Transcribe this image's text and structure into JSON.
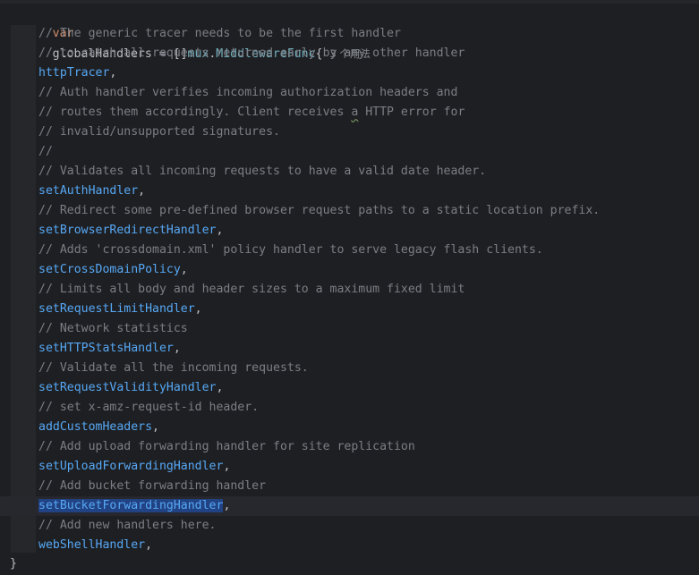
{
  "editor": {
    "declaration": {
      "keyword": "var",
      "name": "globalHandlers",
      "assign": " = ",
      "brackets": "[]",
      "package": "mux",
      "dot": ".",
      "type": "MiddlewareFunc",
      "brace": "{",
      "usage_hint": "3 个用法"
    },
    "lines": [
      {
        "kind": "comment",
        "text": "// The generic tracer needs to be the first handler"
      },
      {
        "kind": "comment",
        "text": "// to catch all requests returned early by any other handler"
      },
      {
        "kind": "handler",
        "name": "httpTracer",
        "suffix": ","
      },
      {
        "kind": "comment",
        "text": "// Auth handler verifies incoming authorization headers and"
      },
      {
        "kind": "comment_typo",
        "before": "// routes them accordingly. Client receives ",
        "typo": "a",
        "after": " HTTP error for"
      },
      {
        "kind": "comment",
        "text": "// invalid/unsupported signatures."
      },
      {
        "kind": "comment",
        "text": "//"
      },
      {
        "kind": "comment",
        "text": "// Validates all incoming requests to have a valid date header."
      },
      {
        "kind": "handler",
        "name": "setAuthHandler",
        "suffix": ","
      },
      {
        "kind": "comment",
        "text": "// Redirect some pre-defined browser request paths to a static location prefix."
      },
      {
        "kind": "handler",
        "name": "setBrowserRedirectHandler",
        "suffix": ","
      },
      {
        "kind": "comment",
        "text": "// Adds 'crossdomain.xml' policy handler to serve legacy flash clients."
      },
      {
        "kind": "handler",
        "name": "setCrossDomainPolicy",
        "suffix": ","
      },
      {
        "kind": "comment",
        "text": "// Limits all body and header sizes to a maximum fixed limit"
      },
      {
        "kind": "handler",
        "name": "setRequestLimitHandler",
        "suffix": ","
      },
      {
        "kind": "comment",
        "text": "// Network statistics"
      },
      {
        "kind": "handler",
        "name": "setHTTPStatsHandler",
        "suffix": ","
      },
      {
        "kind": "comment",
        "text": "// Validate all the incoming requests."
      },
      {
        "kind": "handler",
        "name": "setRequestValidityHandler",
        "suffix": ","
      },
      {
        "kind": "comment",
        "text": "// set x-amz-request-id header."
      },
      {
        "kind": "handler",
        "name": "addCustomHeaders",
        "suffix": ","
      },
      {
        "kind": "comment",
        "text": "// Add upload forwarding handler for site replication"
      },
      {
        "kind": "handler",
        "name": "setUploadForwardingHandler",
        "suffix": ","
      },
      {
        "kind": "comment",
        "text": "// Add bucket forwarding handler"
      },
      {
        "kind": "handler_selected",
        "name": "setBucketForwardingHandler",
        "suffix": ","
      },
      {
        "kind": "comment",
        "text": "// Add new handlers here."
      },
      {
        "kind": "handler",
        "name": "webShellHandler",
        "suffix": ","
      }
    ],
    "closing": "}"
  }
}
